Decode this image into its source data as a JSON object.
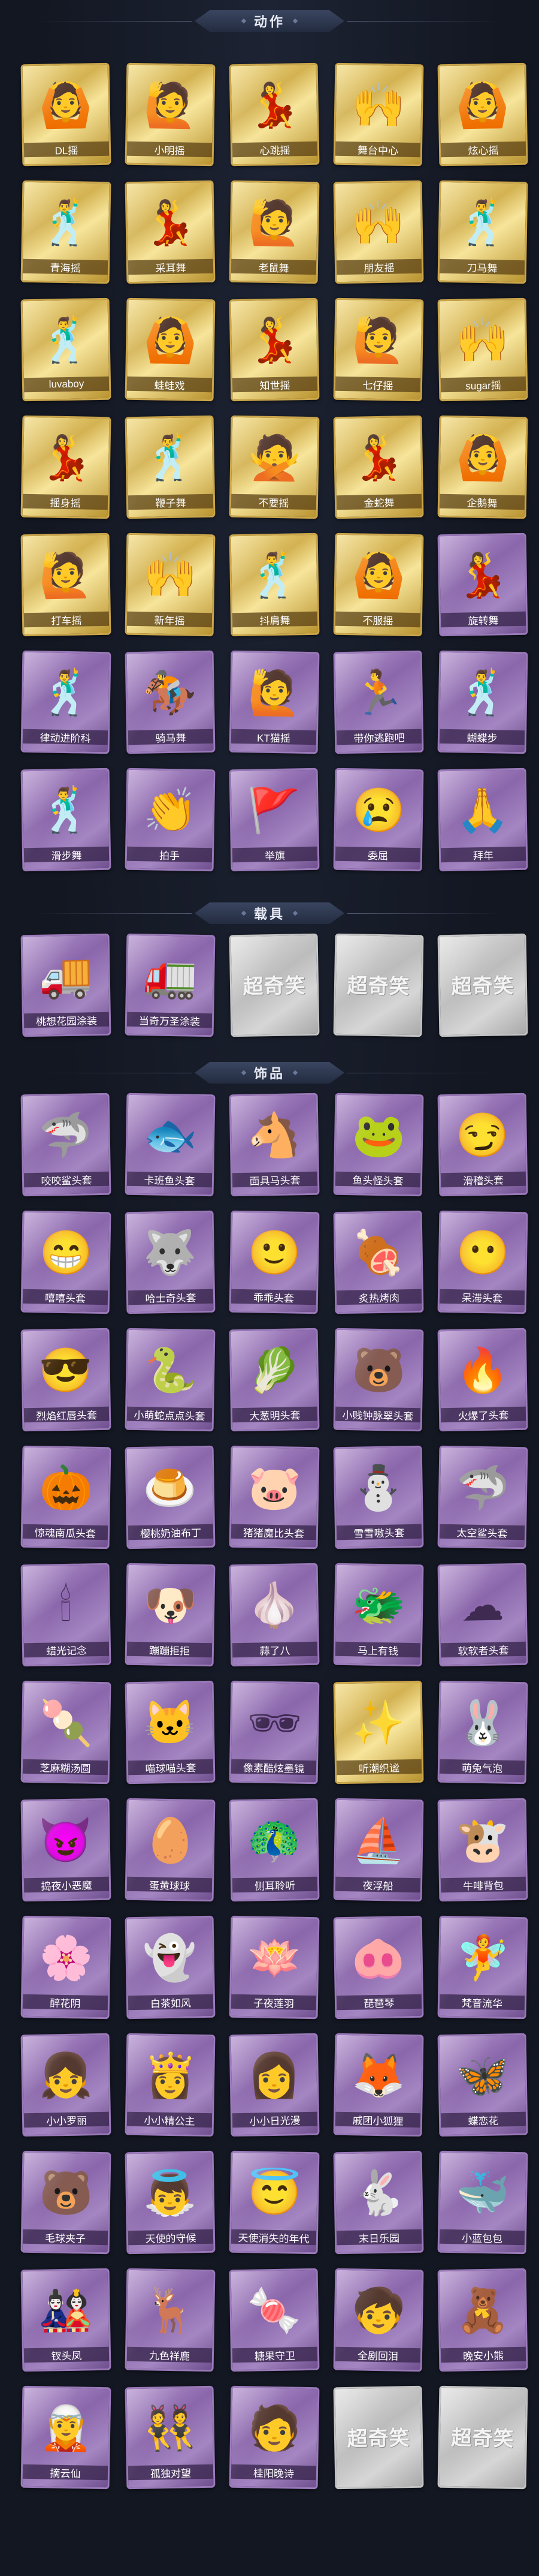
{
  "sections": [
    {
      "title": "动作",
      "items": [
        {
          "label": "DL摇",
          "style": "gold",
          "icon": "dance-pose-icon",
          "glyph": "🙆"
        },
        {
          "label": "小明摇",
          "style": "gold",
          "icon": "dance-pose-icon",
          "glyph": "🙋"
        },
        {
          "label": "心跳摇",
          "style": "gold",
          "icon": "dance-pose-icon",
          "glyph": "💃"
        },
        {
          "label": "舞台中心",
          "style": "gold",
          "icon": "dance-pose-icon",
          "glyph": "🙌"
        },
        {
          "label": "炫心摇",
          "style": "gold",
          "icon": "dance-pose-icon",
          "glyph": "🙆"
        },
        {
          "label": "青海摇",
          "style": "gold",
          "icon": "dance-pose-icon",
          "glyph": "🕺"
        },
        {
          "label": "采耳舞",
          "style": "gold",
          "icon": "dance-pose-icon",
          "glyph": "💃"
        },
        {
          "label": "老鼠舞",
          "style": "gold",
          "icon": "dance-pose-icon",
          "glyph": "🙋"
        },
        {
          "label": "朋友摇",
          "style": "gold",
          "icon": "dance-pose-icon",
          "glyph": "🙌"
        },
        {
          "label": "刀马舞",
          "style": "gold",
          "icon": "dance-pose-icon",
          "glyph": "🕺"
        },
        {
          "label": "luvaboy",
          "style": "gold",
          "icon": "dance-pose-icon",
          "glyph": "🕺"
        },
        {
          "label": "蛙蛙戏",
          "style": "gold",
          "icon": "dance-pose-icon",
          "glyph": "🙆"
        },
        {
          "label": "知世摇",
          "style": "gold",
          "icon": "dance-pose-icon",
          "glyph": "💃"
        },
        {
          "label": "七仔摇",
          "style": "gold",
          "icon": "dance-pose-icon",
          "glyph": "🙋"
        },
        {
          "label": "sugar摇",
          "style": "gold",
          "icon": "dance-pose-icon",
          "glyph": "🙌"
        },
        {
          "label": "摇身摇",
          "style": "gold",
          "icon": "dance-pose-icon",
          "glyph": "💃"
        },
        {
          "label": "鞭子舞",
          "style": "gold",
          "icon": "dance-pose-icon",
          "glyph": "🕺"
        },
        {
          "label": "不要摇",
          "style": "gold",
          "icon": "dance-pose-icon",
          "glyph": "🙅"
        },
        {
          "label": "金蛇舞",
          "style": "gold",
          "icon": "dance-pose-icon",
          "glyph": "💃"
        },
        {
          "label": "企鹅舞",
          "style": "gold",
          "icon": "dance-pose-icon",
          "glyph": "🙆"
        },
        {
          "label": "打车摇",
          "style": "gold",
          "icon": "dance-pose-icon",
          "glyph": "🙋"
        },
        {
          "label": "新年摇",
          "style": "gold",
          "icon": "dance-pose-icon",
          "glyph": "🙌"
        },
        {
          "label": "抖肩舞",
          "style": "gold",
          "icon": "dance-pose-icon",
          "glyph": "🕺"
        },
        {
          "label": "不服摇",
          "style": "gold",
          "icon": "dance-pose-icon",
          "glyph": "🙆"
        },
        {
          "label": "旋转舞",
          "style": "purple",
          "icon": "dance-pose-icon",
          "glyph": "💃"
        },
        {
          "label": "律动进阶科",
          "style": "purple",
          "icon": "dance-pose-icon",
          "glyph": "🕺"
        },
        {
          "label": "骑马舞",
          "style": "purple",
          "icon": "dance-pose-icon",
          "glyph": "🏇"
        },
        {
          "label": "KT猫摇",
          "style": "purple",
          "icon": "dance-pose-icon",
          "glyph": "🙋"
        },
        {
          "label": "带你逃跑吧",
          "style": "purple",
          "icon": "dance-pose-icon",
          "glyph": "🏃"
        },
        {
          "label": "蝴蝶步",
          "style": "purple",
          "icon": "dance-pose-icon",
          "glyph": "🕺"
        },
        {
          "label": "滑步舞",
          "style": "purple",
          "icon": "dance-pose-icon",
          "glyph": "🕺"
        },
        {
          "label": "拍手",
          "style": "purple",
          "icon": "dance-pose-icon",
          "glyph": "👏"
        },
        {
          "label": "举旗",
          "style": "purple",
          "icon": "dance-pose-icon",
          "glyph": "🚩"
        },
        {
          "label": "委屈",
          "style": "purple",
          "icon": "dance-pose-icon",
          "glyph": "😢"
        },
        {
          "label": "拜年",
          "style": "purple",
          "icon": "dance-pose-icon",
          "glyph": "🙏"
        }
      ]
    },
    {
      "title": "载具",
      "items": [
        {
          "label": "桃想花园涂装",
          "style": "purple",
          "icon": "vehicle-icon",
          "glyph": "🚚"
        },
        {
          "label": "当奇万圣涂装",
          "style": "purple",
          "icon": "vehicle-icon",
          "glyph": "🚛"
        },
        {
          "label": "",
          "style": "grey",
          "icon": "placeholder-icon",
          "glyph": "",
          "watermark": "超奇笑"
        },
        {
          "label": "",
          "style": "grey",
          "icon": "placeholder-icon",
          "glyph": "",
          "watermark": "超奇笑"
        },
        {
          "label": "",
          "style": "grey",
          "icon": "placeholder-icon",
          "glyph": "",
          "watermark": "超奇笑"
        }
      ]
    },
    {
      "title": "饰品",
      "items": [
        {
          "label": "咬咬鲨头套",
          "style": "purple",
          "icon": "shark-head-icon",
          "glyph": "🦈"
        },
        {
          "label": "卡班鱼头套",
          "style": "purple",
          "icon": "fish-head-icon",
          "glyph": "🐟"
        },
        {
          "label": "面具马头套",
          "style": "purple",
          "icon": "horse-head-icon",
          "glyph": "🐴"
        },
        {
          "label": "鱼头怪头套",
          "style": "purple",
          "icon": "fish-monster-icon",
          "glyph": "🐸"
        },
        {
          "label": "滑稽头套",
          "style": "purple",
          "icon": "smiley-icon",
          "glyph": "😏"
        },
        {
          "label": "嘻嘻头套",
          "style": "purple",
          "icon": "grin-icon",
          "glyph": "😁"
        },
        {
          "label": "哈士奇头套",
          "style": "purple",
          "icon": "husky-head-icon",
          "glyph": "🐺"
        },
        {
          "label": "乖乖头套",
          "style": "purple",
          "icon": "smile-icon",
          "glyph": "🙂"
        },
        {
          "label": "炙热烤肉",
          "style": "purple",
          "icon": "meat-icon",
          "glyph": "🍖"
        },
        {
          "label": "呆滞头套",
          "style": "purple",
          "icon": "blank-face-icon",
          "glyph": "😶"
        },
        {
          "label": "烈焰红唇头套",
          "style": "purple",
          "icon": "pikachu-head-icon",
          "glyph": "😎"
        },
        {
          "label": "小萌蛇点点头套",
          "style": "purple",
          "icon": "snake-head-icon",
          "glyph": "🐍"
        },
        {
          "label": "大葱明头套",
          "style": "purple",
          "icon": "scallion-head-icon",
          "glyph": "🥬"
        },
        {
          "label": "小贱钟脉翠头套",
          "style": "purple",
          "icon": "cookie-head-icon",
          "glyph": "🐻"
        },
        {
          "label": "火爆了头套",
          "style": "purple",
          "icon": "fire-head-icon",
          "glyph": "🔥"
        },
        {
          "label": "惊魂南瓜头套",
          "style": "purple",
          "icon": "pumpkin-head-icon",
          "glyph": "🎃"
        },
        {
          "label": "樱桃奶油布丁",
          "style": "purple",
          "icon": "pudding-icon",
          "glyph": "🍮"
        },
        {
          "label": "猪猪魔比头套",
          "style": "purple",
          "icon": "pig-head-icon",
          "glyph": "🐷"
        },
        {
          "label": "雪雪嗷头套",
          "style": "purple",
          "icon": "snow-head-icon",
          "glyph": "⛄"
        },
        {
          "label": "太空鲨头套",
          "style": "purple",
          "icon": "space-shark-icon",
          "glyph": "🦈"
        },
        {
          "label": "蜡光记念",
          "style": "purple",
          "icon": "candle-icon",
          "glyph": "🕯"
        },
        {
          "label": "蹦蹦拒拒",
          "style": "purple",
          "icon": "dog-head-icon",
          "glyph": "🐶"
        },
        {
          "label": "蒜了八",
          "style": "purple",
          "icon": "garlic-icon",
          "glyph": "🧄"
        },
        {
          "label": "马上有钱",
          "style": "purple",
          "icon": "money-head-icon",
          "glyph": "🐲"
        },
        {
          "label": "软软者头套",
          "style": "purple",
          "icon": "cloud-head-icon",
          "glyph": "☁"
        },
        {
          "label": "芝麻糊汤圆",
          "style": "purple",
          "icon": "dumpling-head-icon",
          "glyph": "🍡"
        },
        {
          "label": "喵球喵头套",
          "style": "purple",
          "icon": "cat-head-icon",
          "glyph": "🐱"
        },
        {
          "label": "像素酷炫墨镜",
          "style": "purple",
          "icon": "pixel-glasses-icon",
          "glyph": "🕶"
        },
        {
          "label": "听潮织谧",
          "style": "gold",
          "icon": "halo-icon",
          "glyph": "✨"
        },
        {
          "label": "萌兔气泡",
          "style": "purple",
          "icon": "bunny-bubble-icon",
          "glyph": "🐰"
        },
        {
          "label": "捣夜小恶魔",
          "style": "purple",
          "icon": "devil-pet-icon",
          "glyph": "😈"
        },
        {
          "label": "蛋黄球球",
          "style": "purple",
          "icon": "egg-pet-icon",
          "glyph": "🥚"
        },
        {
          "label": "侧耳聆听",
          "style": "purple",
          "icon": "ear-pet-icon",
          "glyph": "🦚"
        },
        {
          "label": "夜浮船",
          "style": "purple",
          "icon": "ship-icon",
          "glyph": "⛵"
        },
        {
          "label": "牛啡背包",
          "style": "purple",
          "icon": "cow-backpack-icon",
          "glyph": "🐮"
        },
        {
          "label": "醉花阴",
          "style": "purple",
          "icon": "flower-doll-icon",
          "glyph": "🌸"
        },
        {
          "label": "白茶如风",
          "style": "purple",
          "icon": "ghost-doll-icon",
          "glyph": "👻"
        },
        {
          "label": "子夜莲羽",
          "style": "purple",
          "icon": "lotus-doll-icon",
          "glyph": "🪷"
        },
        {
          "label": "琵琶琴",
          "style": "purple",
          "icon": "pig-doll-icon",
          "glyph": "🐽"
        },
        {
          "label": "梵音流华",
          "style": "purple",
          "icon": "fairy-doll-icon",
          "glyph": "🧚"
        },
        {
          "label": "小小罗丽",
          "style": "purple",
          "icon": "girl-doll-icon",
          "glyph": "👧"
        },
        {
          "label": "小小精公主",
          "style": "purple",
          "icon": "princess-doll-icon",
          "glyph": "👸"
        },
        {
          "label": "小小日光漫",
          "style": "purple",
          "icon": "girl-doll-icon",
          "glyph": "👩"
        },
        {
          "label": "戚团小狐狸",
          "style": "purple",
          "icon": "fox-doll-icon",
          "glyph": "🦊"
        },
        {
          "label": "蝶恋花",
          "style": "purple",
          "icon": "butterfly-doll-icon",
          "glyph": "🦋"
        },
        {
          "label": "毛球夹子",
          "style": "purple",
          "icon": "bear-doll-icon",
          "glyph": "🐻"
        },
        {
          "label": "天使的守候",
          "style": "purple",
          "icon": "angel-doll-icon",
          "glyph": "👼"
        },
        {
          "label": "天使消失的年代",
          "style": "purple",
          "icon": "angel-doll-icon",
          "glyph": "😇"
        },
        {
          "label": "末日乐园",
          "style": "purple",
          "icon": "bunny-doll-icon",
          "glyph": "🐇"
        },
        {
          "label": "小蓝包包",
          "style": "purple",
          "icon": "whale-doll-icon",
          "glyph": "🐳"
        },
        {
          "label": "钗头凤",
          "style": "purple",
          "icon": "phoenix-doll-icon",
          "glyph": "🎎"
        },
        {
          "label": "九色祥鹿",
          "style": "purple",
          "icon": "deer-doll-icon",
          "glyph": "🦌"
        },
        {
          "label": "糖果守卫",
          "style": "purple",
          "icon": "candy-doll-icon",
          "glyph": "🍬"
        },
        {
          "label": "全剧回泪",
          "style": "purple",
          "icon": "boy-doll-icon",
          "glyph": "🧒"
        },
        {
          "label": "晚安小熊",
          "style": "purple",
          "icon": "bear-doll-icon",
          "glyph": "🧸"
        },
        {
          "label": "摘云仙",
          "style": "purple",
          "icon": "cloud-fairy-icon",
          "glyph": "🧝"
        },
        {
          "label": "孤独对望",
          "style": "purple",
          "icon": "duo-doll-icon",
          "glyph": "👯"
        },
        {
          "label": "桂阳晚诗",
          "style": "purple",
          "icon": "poet-doll-icon",
          "glyph": "🧑"
        },
        {
          "label": "",
          "style": "grey",
          "icon": "placeholder-icon",
          "glyph": "",
          "watermark": "超奇笑"
        },
        {
          "label": "",
          "style": "grey",
          "icon": "placeholder-icon",
          "glyph": "",
          "watermark": "超奇笑"
        }
      ]
    }
  ]
}
